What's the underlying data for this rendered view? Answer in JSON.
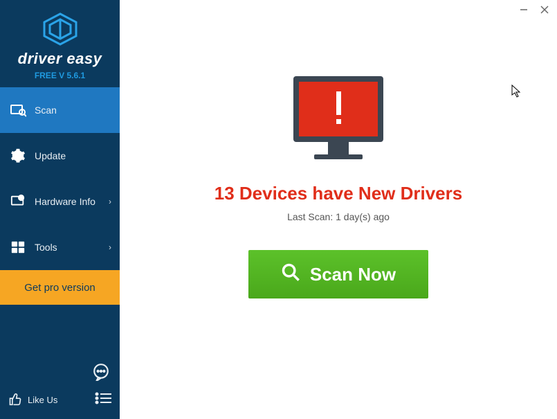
{
  "brand": {
    "name": "driver easy",
    "version": "FREE V 5.6.1"
  },
  "sidebar": {
    "items": [
      {
        "label": "Scan",
        "icon": "scan-icon",
        "has_sub": false
      },
      {
        "label": "Update",
        "icon": "gear-icon",
        "has_sub": false
      },
      {
        "label": "Hardware Info",
        "icon": "hardware-icon",
        "has_sub": true
      },
      {
        "label": "Tools",
        "icon": "tools-icon",
        "has_sub": true
      }
    ],
    "pro_label": "Get pro version",
    "likeus_label": "Like Us"
  },
  "main": {
    "headline": "13 Devices have New Drivers",
    "subline": "Last Scan: 1 day(s) ago",
    "scan_button": "Scan Now"
  },
  "colors": {
    "sidebar_bg": "#0b3a5e",
    "active_bg": "#1f78c1",
    "pro_bg": "#f6a623",
    "alert_red": "#e02e1a",
    "scan_green": "#4caf1f"
  }
}
